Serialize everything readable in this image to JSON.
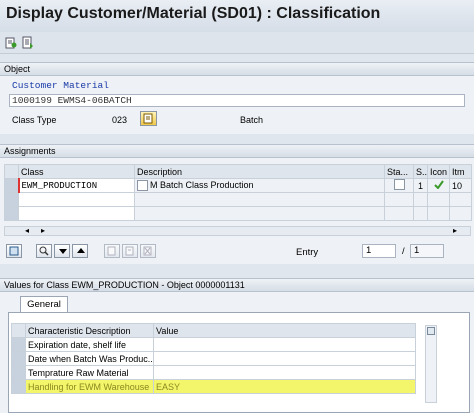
{
  "title": "Display Customer/Material (SD01) : Classification",
  "object_section": {
    "header": "Object",
    "caption": "Customer Material",
    "object_value": "1000199  EWMS4-06BATCH",
    "class_type_label": "Class Type",
    "class_type_value": "023",
    "class_type_text": "Batch"
  },
  "assignments": {
    "header": "Assignments",
    "columns": [
      "Class",
      "Description",
      "Sta...",
      "S...",
      "Icon",
      "Itm"
    ],
    "rows": [
      {
        "class": "EWM_PRODUCTION",
        "description": "M Batch Class Production",
        "s": "1",
        "itm": "10"
      }
    ],
    "entry_label": "Entry",
    "entry_value": "1",
    "entry_sep": "/",
    "entry_total": "1"
  },
  "values": {
    "header": "Values for Class EWM_PRODUCTION - Object 0000001131",
    "tab": "General",
    "columns": [
      "Characteristic Description",
      "Value"
    ],
    "rows": [
      {
        "desc": "Expiration date, shelf life",
        "value": ""
      },
      {
        "desc": "Date when Batch Was Produc...",
        "value": ""
      },
      {
        "desc": "Temprature Raw Material",
        "value": ""
      },
      {
        "desc": "Handling for EWM Warehouse",
        "value": "EASY"
      }
    ]
  },
  "colors": {
    "highlight": "#f3f56a",
    "check_green": "#3a9a2a",
    "text_blue": "#1a3aa8"
  }
}
